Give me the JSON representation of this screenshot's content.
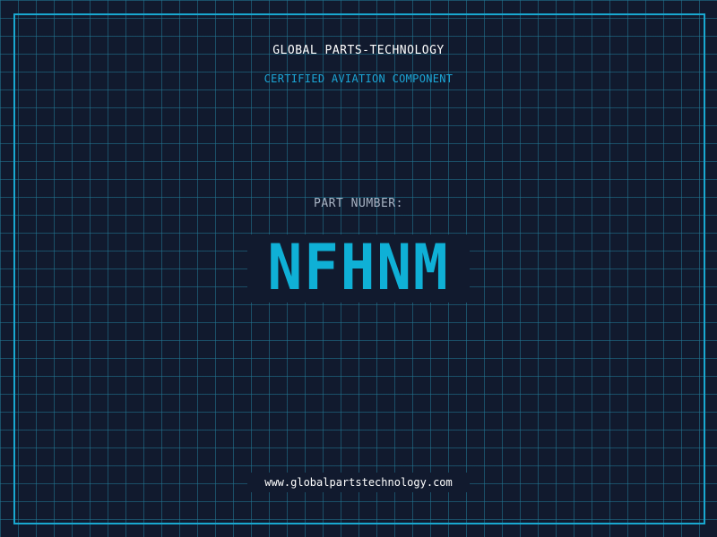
{
  "header": {
    "company_name": "GLOBAL PARTS-TECHNOLOGY",
    "subtitle": "CERTIFIED AVIATION COMPONENT"
  },
  "part": {
    "label": "PART NUMBER:",
    "number": "NFHNM"
  },
  "footer": {
    "website": "www.globalpartstechnology.com"
  },
  "colors": {
    "background": "#111a2e",
    "grid": "#227a96",
    "border": "#19a8d0",
    "accent": "#0fb0d6",
    "label": "#a9b4c4",
    "text": "#ffffff"
  }
}
